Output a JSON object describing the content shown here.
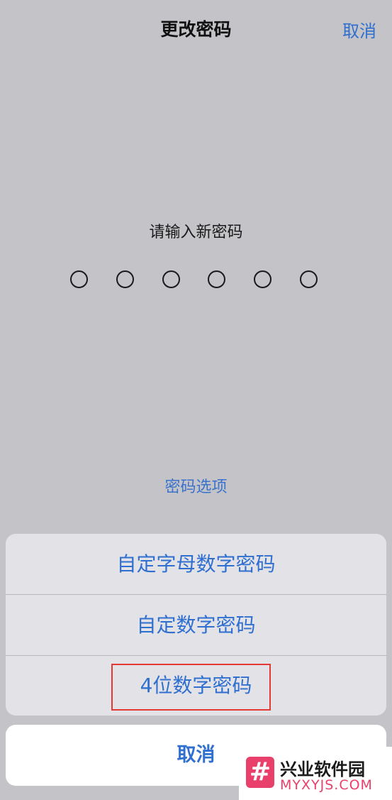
{
  "nav": {
    "title": "更改密码",
    "cancel_label": "取消"
  },
  "prompt": "请输入新密码",
  "passcode": {
    "length": 6,
    "filled": 0
  },
  "options_link": "密码选项",
  "action_sheet": {
    "items": [
      {
        "label": "自定字母数字密码"
      },
      {
        "label": "自定数字密码"
      },
      {
        "label": "4位数字密码"
      }
    ],
    "cancel_label": "取消"
  },
  "watermark": {
    "logo_glyph": "#",
    "title": "兴业软件园",
    "url": "MYXYJS.COM"
  },
  "colors": {
    "accent": "#2f6fd0",
    "background": "#c4c3c8",
    "highlight": "#e53935",
    "watermark": "#e8406a"
  }
}
